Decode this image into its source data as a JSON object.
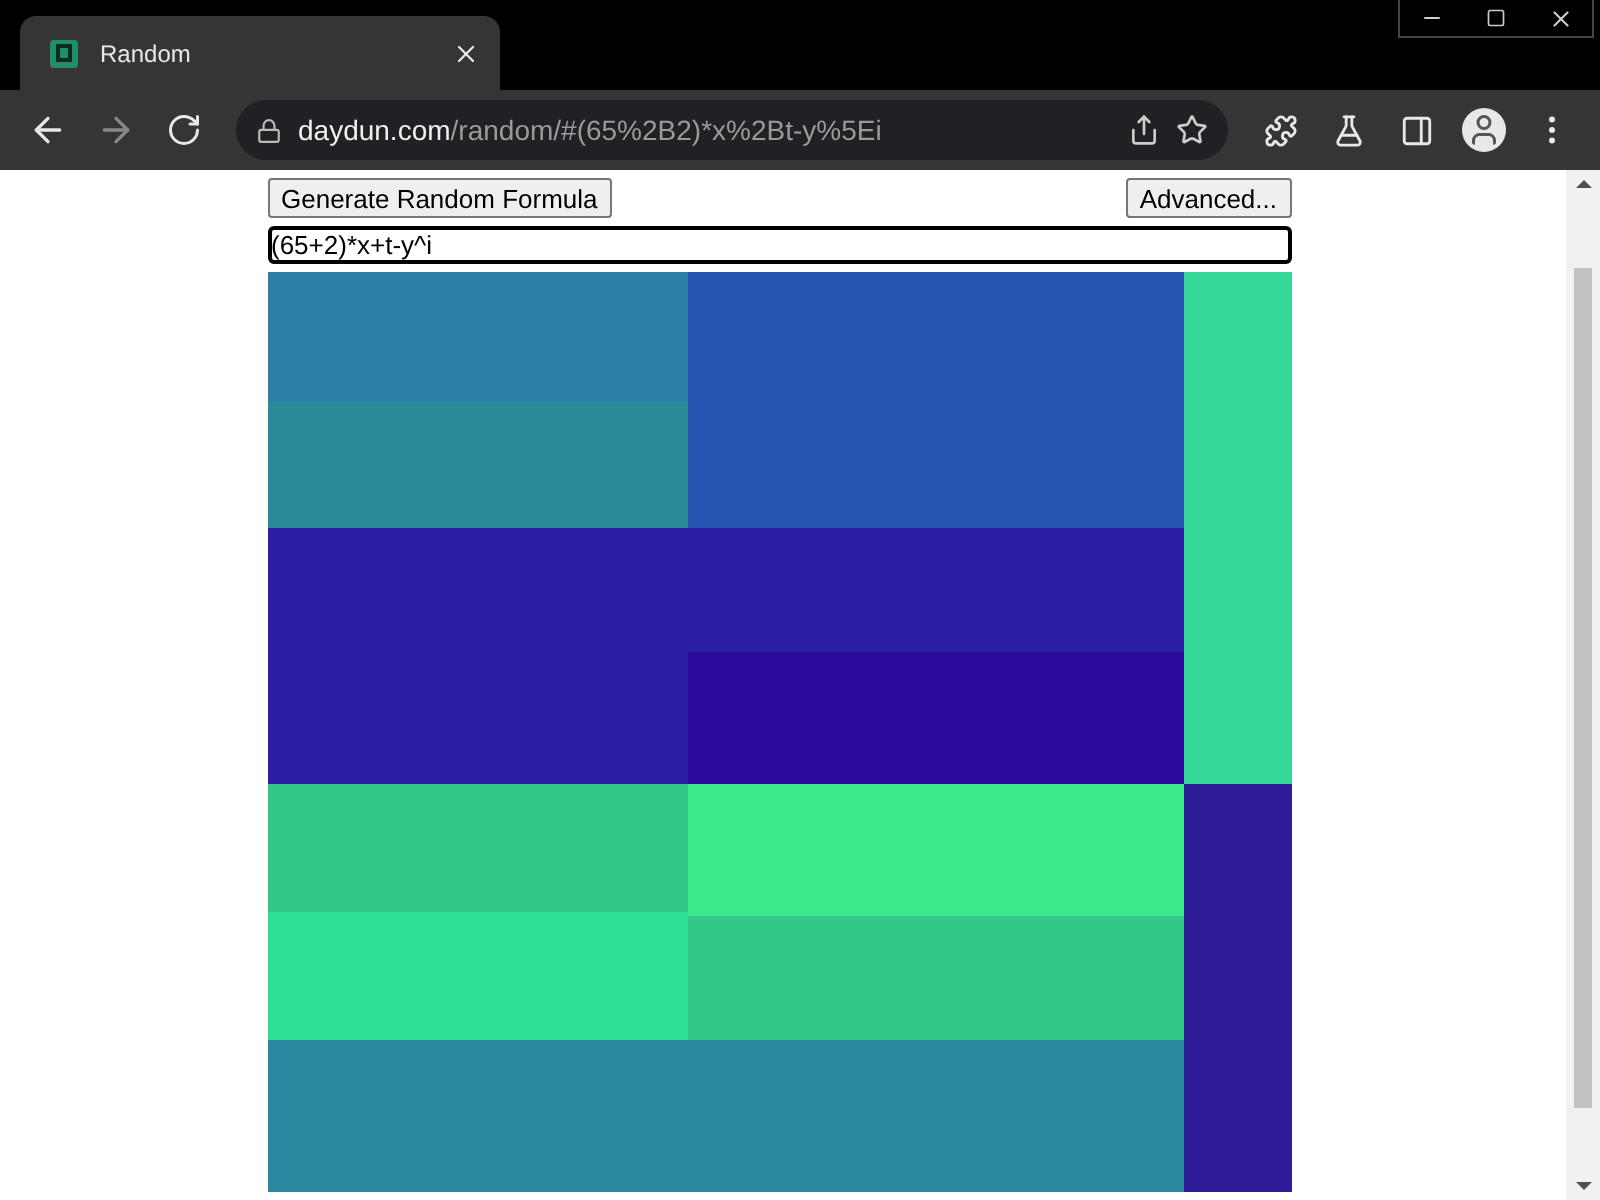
{
  "tab": {
    "title": "Random",
    "selected": true
  },
  "address_bar": {
    "host": "daydun.com",
    "path": "/random/#(65%2B2)*x%2Bt-y%5Ei"
  },
  "page": {
    "generate_button": "Generate Random Formula",
    "advanced_button": "Advanced...",
    "formula": {
      "value": "(65+2)*x+t-y^i"
    }
  }
}
